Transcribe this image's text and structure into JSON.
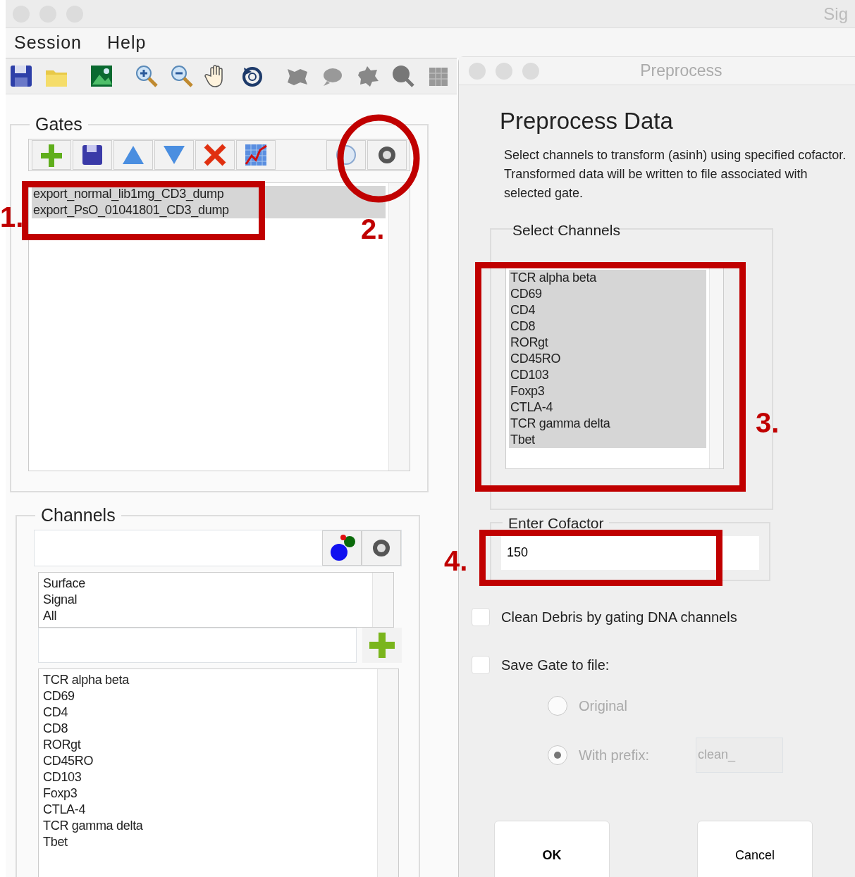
{
  "main_window": {
    "title": "Sig"
  },
  "menu": [
    {
      "label": "Session"
    },
    {
      "label": "Help"
    }
  ],
  "gates": {
    "title": "Gates",
    "items": [
      {
        "label": "export_normal_lib1mg_CD3_dump",
        "selected": true
      },
      {
        "label": "export_PsO_01041801_CD3_dump",
        "selected": true
      }
    ]
  },
  "channels": {
    "title": "Channels",
    "groups": [
      "Surface",
      "Signal",
      "All"
    ],
    "items": [
      "TCR alpha beta",
      "CD69",
      "CD4",
      "CD8",
      "RORgt",
      "CD45RO",
      "CD103",
      "Foxp3",
      "CTLA-4",
      "TCR gamma delta",
      "Tbet"
    ]
  },
  "dialog": {
    "title": "Preprocess",
    "heading": "Preprocess Data",
    "description": "Select channels to transform (asinh) using specified cofactor. Transformed data will be written to file associated with selected gate.",
    "select_channels": {
      "title": "Select Channels",
      "items": [
        {
          "label": "TCR alpha beta",
          "selected": true
        },
        {
          "label": "CD69",
          "selected": true
        },
        {
          "label": "CD4",
          "selected": true
        },
        {
          "label": "CD8",
          "selected": true
        },
        {
          "label": "RORgt",
          "selected": true
        },
        {
          "label": "CD45RO",
          "selected": true
        },
        {
          "label": "CD103",
          "selected": true
        },
        {
          "label": "Foxp3",
          "selected": true
        },
        {
          "label": "CTLA-4",
          "selected": true
        },
        {
          "label": "TCR gamma delta",
          "selected": true
        },
        {
          "label": "Tbet",
          "selected": true
        }
      ]
    },
    "cofactor": {
      "title": "Enter Cofactor",
      "value": "150"
    },
    "options": [
      {
        "label": "Clean Debris by gating DNA channels",
        "checked": false
      },
      {
        "label": "Save Gate to file:",
        "checked": false
      }
    ],
    "save_modes": [
      {
        "label": "Original",
        "selected": false,
        "disabled": true
      },
      {
        "label": "With prefix:",
        "selected": true,
        "disabled": true
      }
    ],
    "prefix": {
      "value": "clean_",
      "disabled": true
    },
    "buttons": [
      {
        "label": "OK"
      },
      {
        "label": "Cancel"
      }
    ]
  },
  "annotations": [
    {
      "label": "1.",
      "kind": "box"
    },
    {
      "label": "2.",
      "kind": "circle"
    },
    {
      "label": "3.",
      "kind": "box"
    },
    {
      "label": "4.",
      "kind": "box"
    }
  ]
}
